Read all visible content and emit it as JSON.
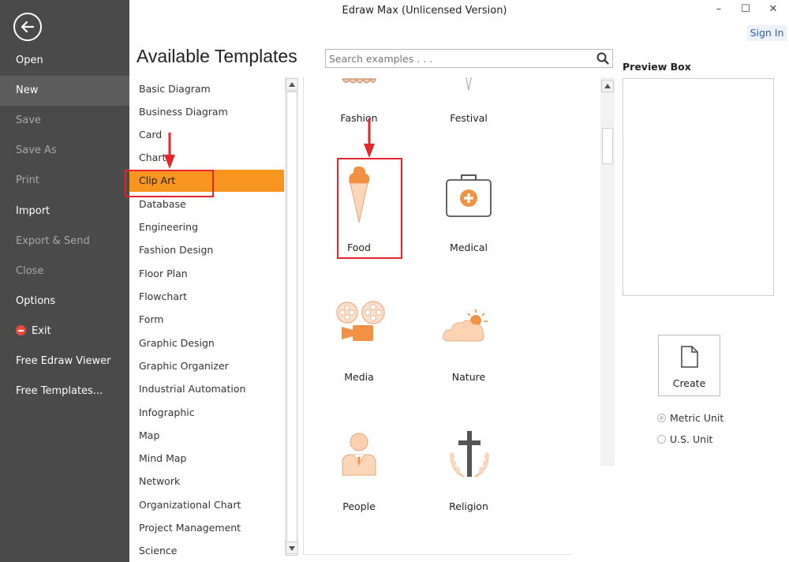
{
  "window": {
    "title": "Edraw Max (Unlicensed Version)",
    "minimize": "–",
    "maximize": "☐",
    "close": "✕",
    "sign_in": "Sign In"
  },
  "sidebar": {
    "items": [
      {
        "label": "Open"
      },
      {
        "label": "New"
      },
      {
        "label": "Save"
      },
      {
        "label": "Save As"
      },
      {
        "label": "Print"
      },
      {
        "label": "Import"
      },
      {
        "label": "Export & Send"
      },
      {
        "label": "Close"
      },
      {
        "label": "Options"
      },
      {
        "label": "Exit"
      },
      {
        "label": "Free Edraw Viewer"
      },
      {
        "label": "Free Templates..."
      }
    ]
  },
  "main": {
    "heading": "Available Templates",
    "search_placeholder": "Search examples . . .",
    "categories": [
      "Basic Diagram",
      "Business Diagram",
      "Card",
      "Chart",
      "Clip Art",
      "Database",
      "Engineering",
      "Fashion Design",
      "Floor Plan",
      "Flowchart",
      "Form",
      "Graphic Design",
      "Graphic Organizer",
      "Industrial Automation",
      "Infographic",
      "Map",
      "Mind Map",
      "Network",
      "Organizational Chart",
      "Project Management",
      "Science"
    ],
    "selected_category": "Clip Art",
    "templates": [
      {
        "label": "Fashion",
        "icon": "fashion-icon"
      },
      {
        "label": "Festival",
        "icon": "festival-icon"
      },
      {
        "label": "Food",
        "icon": "ice-cream-cone-icon"
      },
      {
        "label": "Medical",
        "icon": "first-aid-kit-icon"
      },
      {
        "label": "Media",
        "icon": "film-camera-icon"
      },
      {
        "label": "Nature",
        "icon": "cloud-sun-icon"
      },
      {
        "label": "People",
        "icon": "person-icon"
      },
      {
        "label": "Religion",
        "icon": "cross-icon"
      }
    ]
  },
  "preview": {
    "label": "Preview Box",
    "create_label": "Create",
    "units": [
      {
        "label": "Metric Unit",
        "selected": true
      },
      {
        "label": "U.S. Unit",
        "selected": false
      }
    ]
  },
  "colors": {
    "sidebar_bg": "#4a4a4a",
    "accent_orange": "#f7951e",
    "annotation_red": "#e3262b",
    "link_blue": "#2a5db0"
  }
}
